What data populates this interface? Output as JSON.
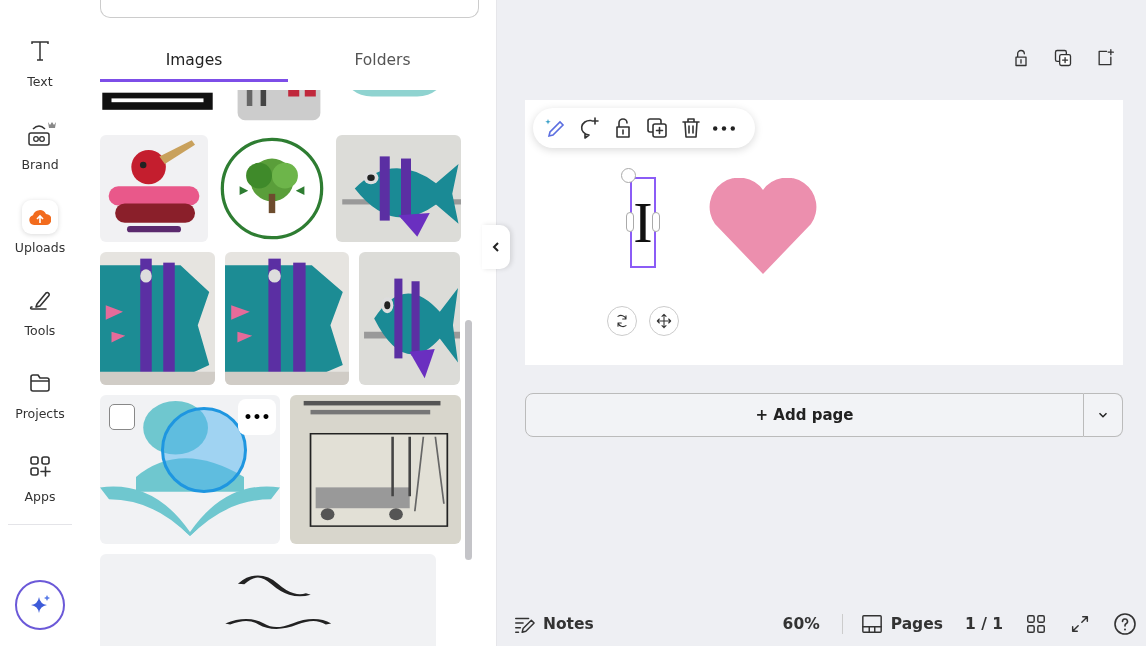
{
  "rail": [
    {
      "kind": "text",
      "label": "Text",
      "selected": false
    },
    {
      "kind": "brand",
      "label": "Brand",
      "selected": false
    },
    {
      "kind": "uploads",
      "label": "Uploads",
      "selected": true
    },
    {
      "kind": "tools",
      "label": "Tools",
      "selected": false
    },
    {
      "kind": "projects",
      "label": "Projects",
      "selected": false
    },
    {
      "kind": "apps",
      "label": "Apps",
      "selected": false
    }
  ],
  "tabs": [
    {
      "label": "Images",
      "selected": true
    },
    {
      "label": "Folders",
      "selected": false
    }
  ],
  "hovered_image": {
    "checked": false,
    "menu": "•••"
  },
  "canvas": {
    "text_element": "I"
  },
  "add_page": "+ Add page",
  "footer": {
    "notes": "Notes",
    "zoom": "60%",
    "pages": "Pages",
    "page_count": "1 / 1"
  }
}
